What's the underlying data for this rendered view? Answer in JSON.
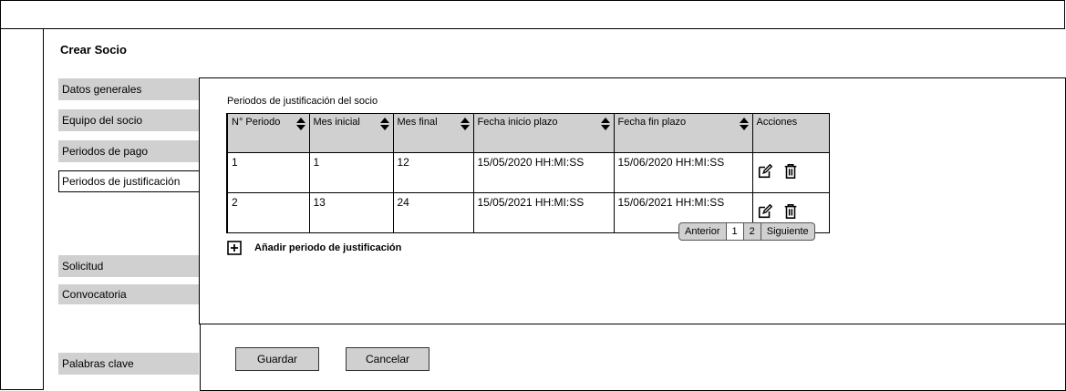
{
  "page": {
    "title": "Crear Socio"
  },
  "sidebar": {
    "items": [
      {
        "label": "Datos generales"
      },
      {
        "label": "Equipo del socio"
      },
      {
        "label": "Periodos de pago"
      },
      {
        "label": "Periodos de justificación",
        "active": true
      },
      {
        "label": "Solicitud"
      },
      {
        "label": "Convocatoria"
      },
      {
        "label": "Palabras clave"
      }
    ]
  },
  "section": {
    "title": "Periodos de justificación del socio"
  },
  "table": {
    "columns": [
      {
        "label": "N° Periodo",
        "sortable": true
      },
      {
        "label": "Mes inicial",
        "sortable": true
      },
      {
        "label": "Mes final",
        "sortable": true
      },
      {
        "label": "Fecha inicio plazo",
        "sortable": true
      },
      {
        "label": "Fecha fin plazo",
        "sortable": true
      },
      {
        "label": "Acciones",
        "sortable": false
      }
    ],
    "rows": [
      {
        "periodo": "1",
        "mes_inicial": "1",
        "mes_final": "12",
        "fecha_inicio": "15/05/2020 HH:MI:SS",
        "fecha_fin": "15/06/2020 HH:MI:SS"
      },
      {
        "periodo": "2",
        "mes_inicial": "13",
        "mes_final": "24",
        "fecha_inicio": "15/05/2021 HH:MI:SS",
        "fecha_fin": "15/06/2021 HH:MI:SS"
      }
    ],
    "row_action_icons": [
      "edit-icon",
      "trash-icon"
    ]
  },
  "pagination": {
    "previous": "Anterior",
    "pages": [
      "1",
      "2"
    ],
    "next": "Siguiente"
  },
  "add_action": {
    "label": "Añadir periodo de justificación",
    "icon": "plus-square-icon"
  },
  "footer": {
    "save_label": "Guardar",
    "cancel_label": "Cancelar"
  }
}
